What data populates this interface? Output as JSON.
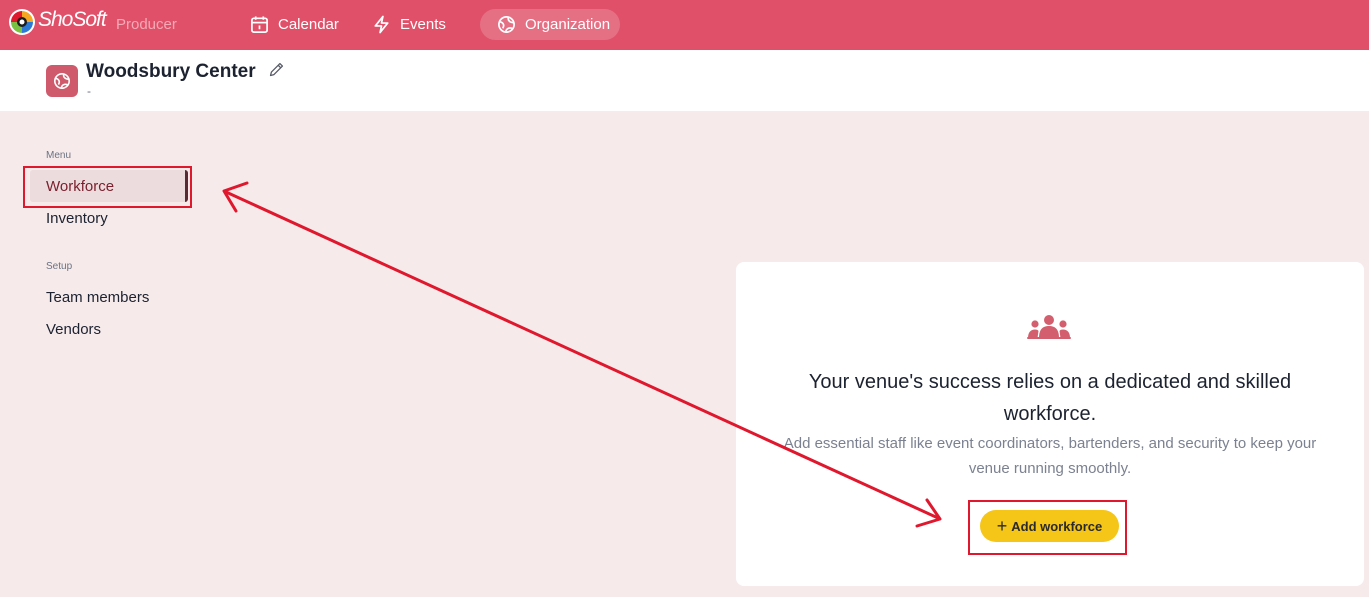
{
  "app": {
    "logo_text": "ShoSoft",
    "logo_sub": "Producer"
  },
  "nav": {
    "items": [
      {
        "label": "Calendar",
        "icon": "calendar-icon"
      },
      {
        "label": "Events",
        "icon": "lightning-icon"
      },
      {
        "label": "Organization",
        "icon": "globe-icon",
        "active": true
      }
    ]
  },
  "header": {
    "org_name": "Woodsbury Center",
    "org_sub": "-"
  },
  "sidebar": {
    "menu_label": "Menu",
    "menu_items": [
      {
        "label": "Workforce",
        "active": true
      },
      {
        "label": "Inventory"
      }
    ],
    "setup_label": "Setup",
    "setup_items": [
      {
        "label": "Team members"
      },
      {
        "label": "Vendors"
      }
    ]
  },
  "empty_state": {
    "icon": "team-group-icon",
    "title": "Your venue's success relies on a dedicated and skilled workforce.",
    "description": "Add essential staff like event coordinators, bartenders, and security to keep your venue running smoothly.",
    "button_label": "Add workforce"
  },
  "colors": {
    "brand": "#e05169",
    "accent_button": "#f5c518",
    "annotation": "#e0182d",
    "background": "#f6eaeb"
  }
}
